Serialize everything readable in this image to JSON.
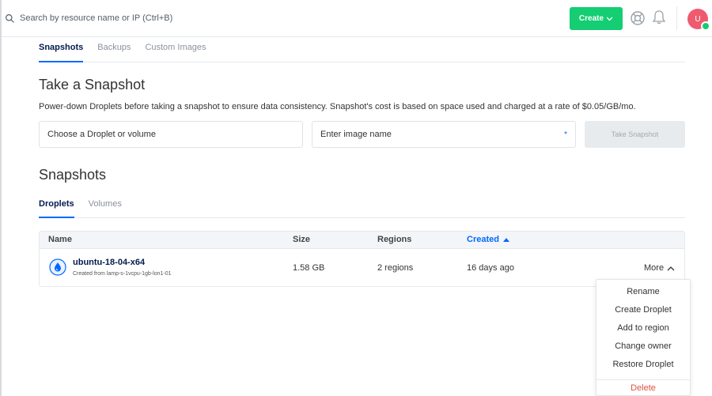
{
  "header": {
    "search_placeholder": "Search by resource name or IP (Ctrl+B)",
    "create_label": "Create",
    "avatar_initial": "U"
  },
  "top_tabs": [
    {
      "label": "Snapshots",
      "active": true
    },
    {
      "label": "Backups",
      "active": false
    },
    {
      "label": "Custom Images",
      "active": false
    }
  ],
  "take_snapshot": {
    "title": "Take a Snapshot",
    "description": "Power-down Droplets before taking a snapshot to ensure data consistency. Snapshot's cost is based on space used and charged at a rate of $0.05/GB/mo.",
    "droplet_placeholder": "Choose a Droplet or volume",
    "name_placeholder": "Enter image name",
    "required_mark": "*",
    "button_label": "Take Snapshot"
  },
  "snapshots": {
    "title": "Snapshots",
    "tabs": [
      {
        "label": "Droplets",
        "active": true
      },
      {
        "label": "Volumes",
        "active": false
      }
    ],
    "columns": [
      "Name",
      "Size",
      "Regions",
      "Created"
    ],
    "rows": [
      {
        "name": "ubuntu-18-04-x64",
        "subtitle": "Created from lamp-s-1vcpu-1gb-lon1-01",
        "size": "1.58 GB",
        "regions": "2 regions",
        "created": "16 days ago",
        "more_label": "More"
      }
    ]
  },
  "more_menu": {
    "items": [
      "Rename",
      "Create Droplet",
      "Add to region",
      "Change owner",
      "Restore Droplet"
    ],
    "danger_item": "Delete"
  },
  "colors": {
    "accent": "#0069ff",
    "create_button": "#15cd72",
    "danger": "#e0523f",
    "avatar": "#f05a6e"
  }
}
